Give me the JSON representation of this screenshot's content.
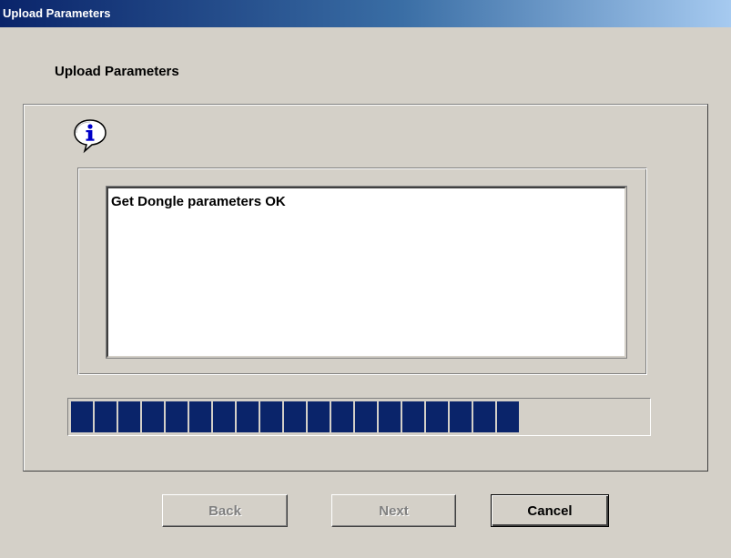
{
  "window": {
    "title": "Upload Parameters"
  },
  "page": {
    "heading": "Upload Parameters"
  },
  "icons": {
    "info": "information-icon"
  },
  "message": {
    "text": "Get Dongle parameters OK"
  },
  "progress": {
    "blocks_filled": 19,
    "fraction": 0.78
  },
  "buttons": {
    "back_label": "Back",
    "next_label": "Next",
    "cancel_label": "Cancel"
  },
  "colors": {
    "title_start": "#0a246a",
    "title_end": "#a6caf0",
    "progress_block": "#0a246a",
    "face": "#d4d0c8"
  }
}
